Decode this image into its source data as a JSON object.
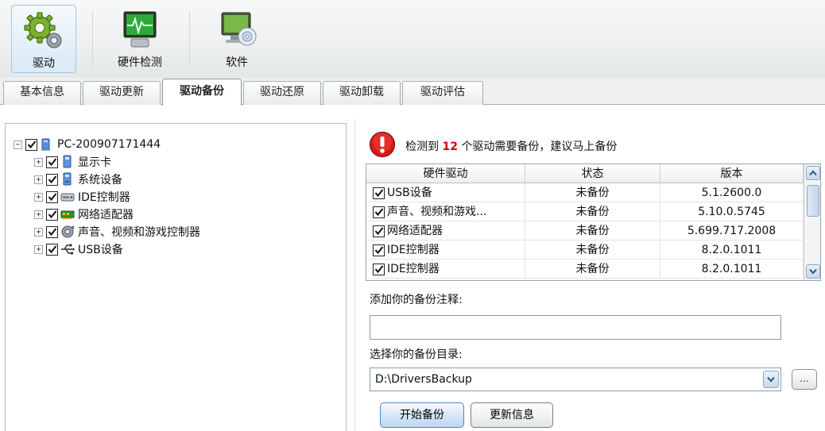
{
  "toolbar": {
    "buttons": [
      {
        "label": "驱动",
        "icon": "gears-icon"
      },
      {
        "label": "硬件检测",
        "icon": "monitor-pulse-icon"
      },
      {
        "label": "软件",
        "icon": "monitor-disc-icon"
      }
    ]
  },
  "tabs": [
    "基本信息",
    "驱动更新",
    "驱动备份",
    "驱动还原",
    "驱动卸载",
    "驱动评估"
  ],
  "active_tab": "驱动备份",
  "tree": {
    "root": {
      "label": "PC-200907171444",
      "expander": "⊟",
      "checked": true,
      "icon": "computer-icon"
    },
    "children": [
      {
        "label": "显示卡",
        "expander": "+",
        "checked": true,
        "icon": "display-adapter-icon"
      },
      {
        "label": "系统设备",
        "expander": "+",
        "checked": true,
        "icon": "system-device-icon"
      },
      {
        "label": "IDE控制器",
        "expander": "+",
        "checked": true,
        "icon": "ide-controller-icon"
      },
      {
        "label": "网络适配器",
        "expander": "+",
        "checked": true,
        "icon": "network-adapter-icon"
      },
      {
        "label": "声音、视频和游戏控制器",
        "expander": "+",
        "checked": true,
        "icon": "sound-icon"
      },
      {
        "label": "USB设备",
        "expander": "+",
        "checked": true,
        "icon": "usb-icon"
      }
    ]
  },
  "alert": {
    "prefix": "检测到 ",
    "count": "12",
    "suffix": " 个驱动需要备份，建议马上备份",
    "icon": "exclamation-icon"
  },
  "grid": {
    "headers": [
      "硬件驱动",
      "状态",
      "版本"
    ],
    "rows": [
      {
        "name": "USB设备",
        "status": "未备份",
        "version": "5.1.2600.0",
        "checked": true
      },
      {
        "name": "声音、视频和游戏...",
        "status": "未备份",
        "version": "5.10.0.5745",
        "checked": true
      },
      {
        "name": "网络适配器",
        "status": "未备份",
        "version": "5.699.717.2008",
        "checked": true
      },
      {
        "name": "IDE控制器",
        "status": "未备份",
        "version": "8.2.0.1011",
        "checked": true
      },
      {
        "name": "IDE控制器",
        "status": "未备份",
        "version": "8.2.0.1011",
        "checked": true
      }
    ]
  },
  "form": {
    "note_label": "添加你的备份注释:",
    "note_value": "",
    "dir_label": "选择你的备份目录:",
    "dir_value": "D:\\DriversBackup",
    "browse_label": "...",
    "start_button": "开始备份",
    "update_button": "更新信息"
  },
  "colors": {
    "alert_count": "#d40000",
    "alert_icon": "#d71a1a",
    "accent": "#4f86c6"
  }
}
